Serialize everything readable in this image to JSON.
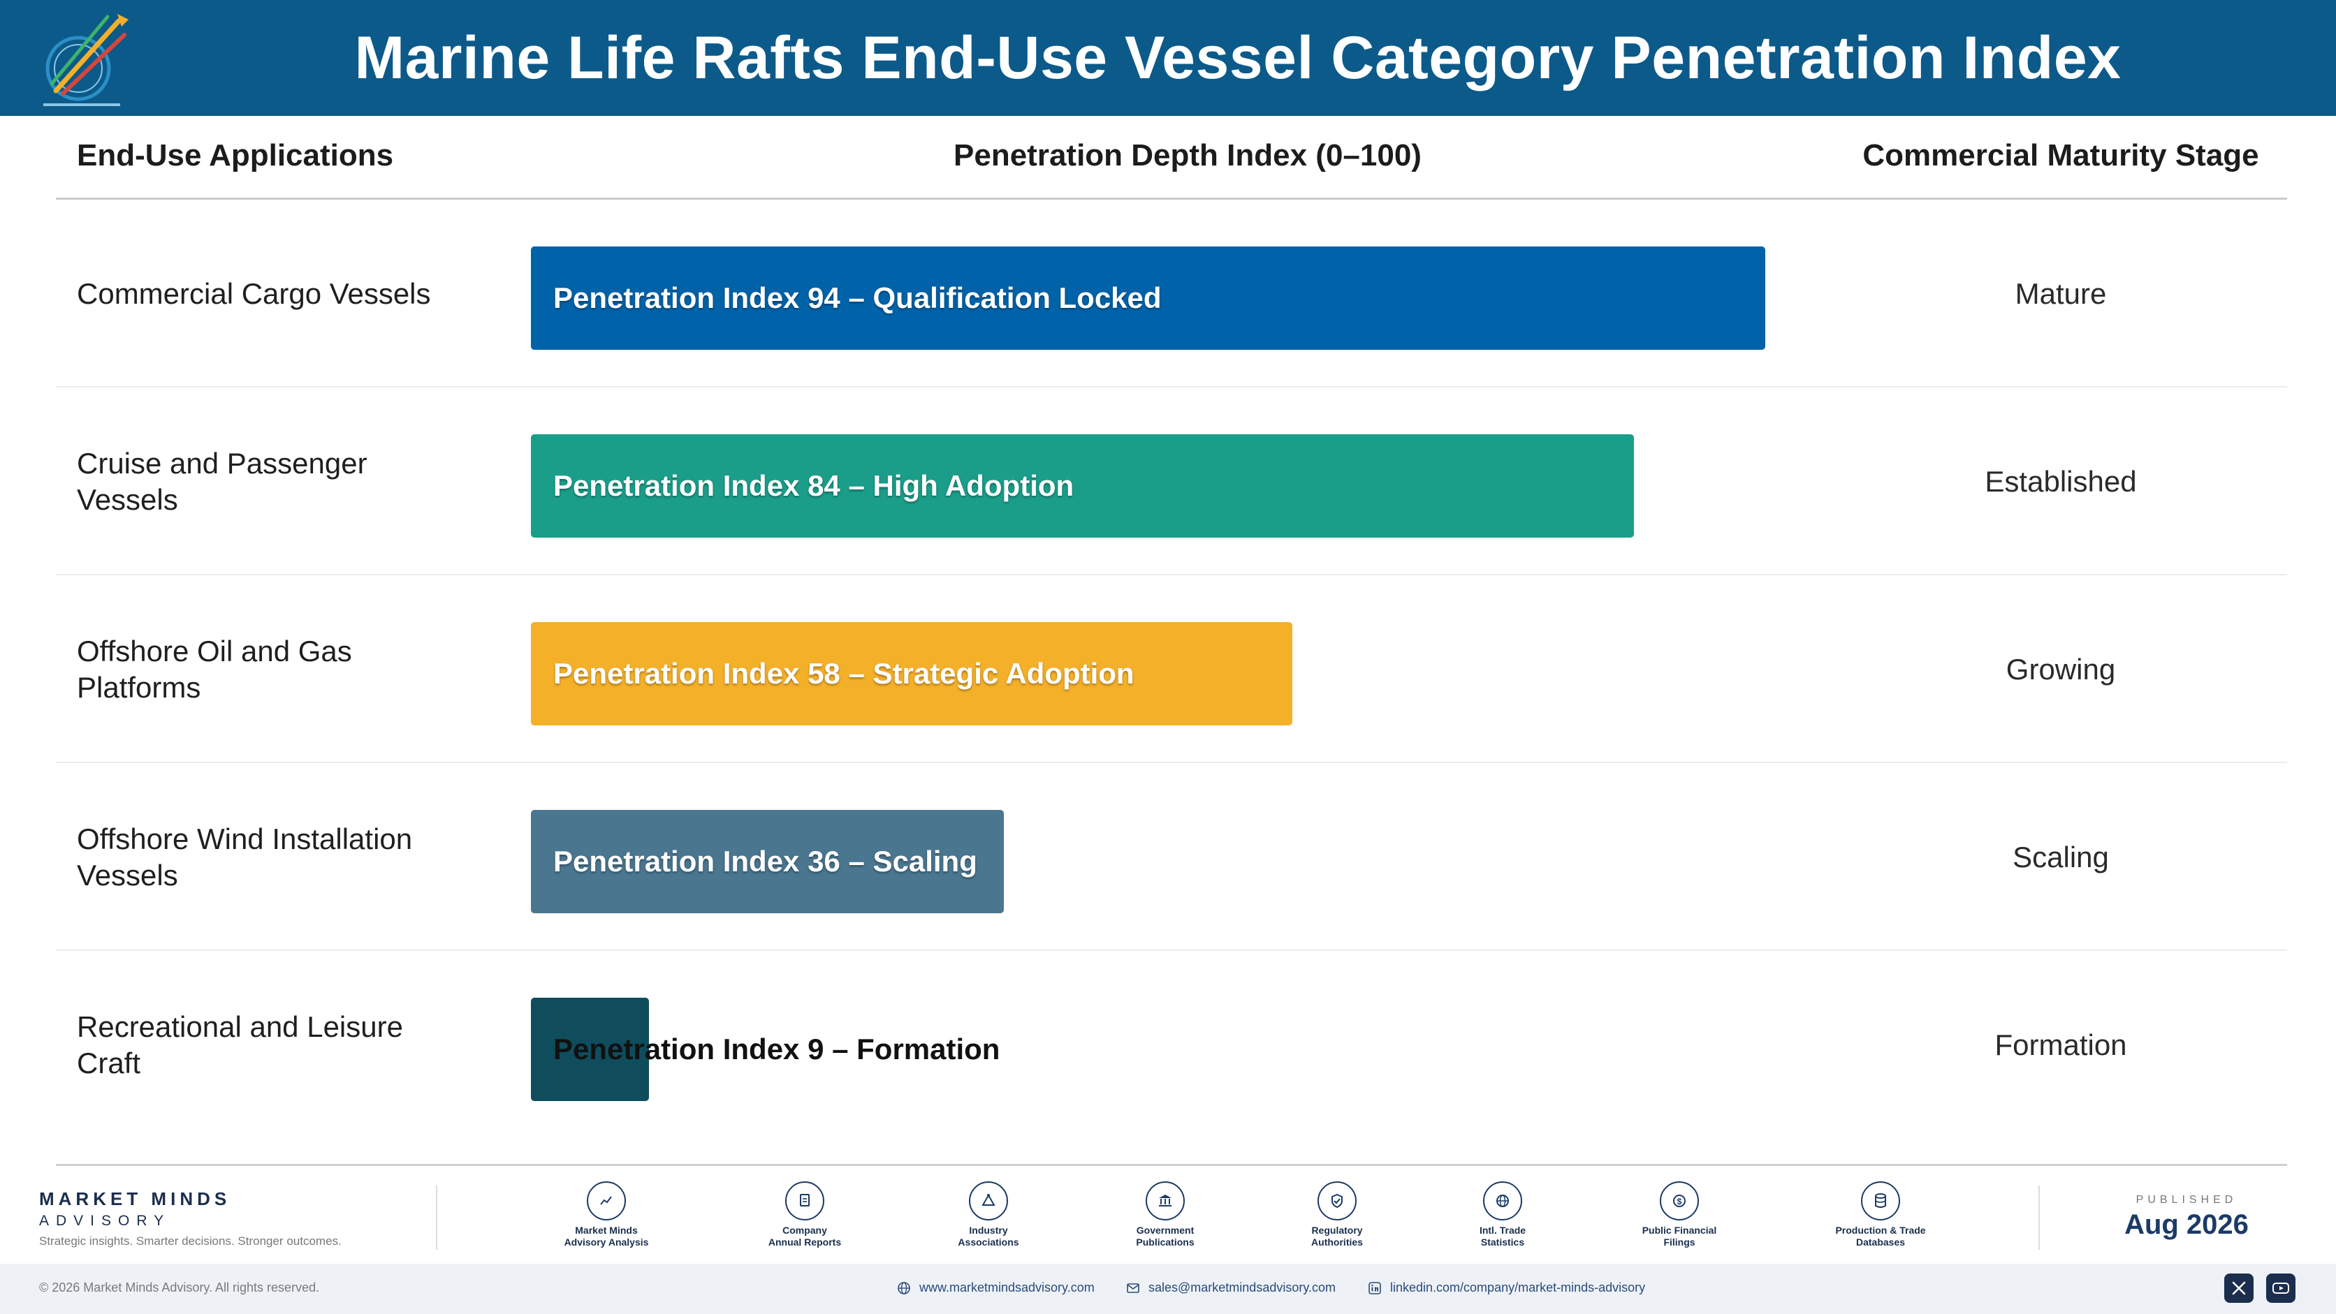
{
  "header": {
    "title": "Marine Life Rafts End-Use Vessel Category Penetration Index"
  },
  "columns": {
    "applications": "End-Use Applications",
    "index": "Penetration Depth Index (0–100)",
    "stage": "Commercial Maturity Stage"
  },
  "chart_data": {
    "type": "bar",
    "orientation": "horizontal",
    "xlim": [
      0,
      100
    ],
    "categories": [
      "Commercial Cargo Vessels",
      "Cruise and Passenger Vessels",
      "Offshore Oil and Gas Platforms",
      "Offshore Wind Installation Vessels",
      "Recreational and Leisure Craft"
    ],
    "values": [
      94,
      84,
      58,
      36,
      9
    ],
    "bar_labels": [
      "Penetration Index 94 – Qualification Locked",
      "Penetration Index 84 – High Adoption",
      "Penetration Index 58 – Strategic Adoption",
      "Penetration Index 36 – Scaling",
      "Penetration Index 9 – Formation"
    ],
    "stages": [
      "Mature",
      "Established",
      "Growing",
      "Scaling",
      "Formation"
    ],
    "colors": [
      "#0062a8",
      "#1a9e8a",
      "#f5b02a",
      "#4a7690",
      "#0f4d5c"
    ],
    "grid": false
  },
  "footer": {
    "brand_name": "MARKET MINDS",
    "brand_sub": "ADVISORY",
    "tagline": "Strategic insights. Smarter decisions. Stronger outcomes.",
    "sources": [
      {
        "label": "Market Minds\nAdvisory Analysis",
        "icon": "trend-chart-icon"
      },
      {
        "label": "Company\nAnnual Reports",
        "icon": "document-icon"
      },
      {
        "label": "Industry\nAssociations",
        "icon": "network-icon"
      },
      {
        "label": "Government\nPublications",
        "icon": "government-building-icon"
      },
      {
        "label": "Regulatory\nAuthorities",
        "icon": "shield-check-icon"
      },
      {
        "label": "Intl. Trade\nStatistics",
        "icon": "globe-icon"
      },
      {
        "label": "Public Financial\nFilings",
        "icon": "dollar-coin-icon"
      },
      {
        "label": "Production & Trade\nDatabases",
        "icon": "database-icon"
      }
    ],
    "published_label": "PUBLISHED",
    "published_date": "Aug 2026"
  },
  "bottom": {
    "copyright": "© 2026 Market Minds Advisory. All rights reserved.",
    "website": "www.marketmindsadvisory.com",
    "email": "sales@marketmindsadvisory.com",
    "linkedin": "linkedin.com/company/market-minds-advisory"
  },
  "colors": {
    "header_bg": "#0c5a8a",
    "brand_navy": "#1b2e4e"
  }
}
